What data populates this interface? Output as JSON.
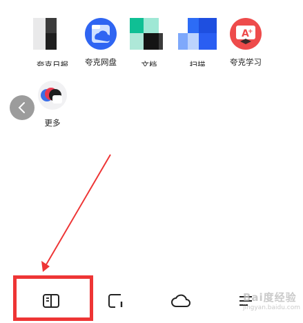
{
  "apps": [
    {
      "label": "夸克日报",
      "icon": "daily-news-icon"
    },
    {
      "label": "夸克网盘",
      "icon": "cloud-drive-icon"
    },
    {
      "label": "文档",
      "icon": "document-icon"
    },
    {
      "label": "扫描",
      "icon": "scan-icon"
    },
    {
      "label": "夸克学习",
      "icon": "study-icon"
    }
  ],
  "more": {
    "label": "更多",
    "icon": "more-apps-icon"
  },
  "nav": {
    "bookmarks_icon": "book-icon",
    "tabs_icon": "tabs-icon",
    "cloud_icon": "cloud-icon",
    "menu_icon": "menu-icon"
  },
  "watermark": {
    "text": "Bai度经验",
    "sub": "jingyan.baidu.com"
  },
  "colors": {
    "highlight": "#ee3535",
    "arrow": "#ee3535",
    "accent_blue": "#2d6cf6"
  }
}
